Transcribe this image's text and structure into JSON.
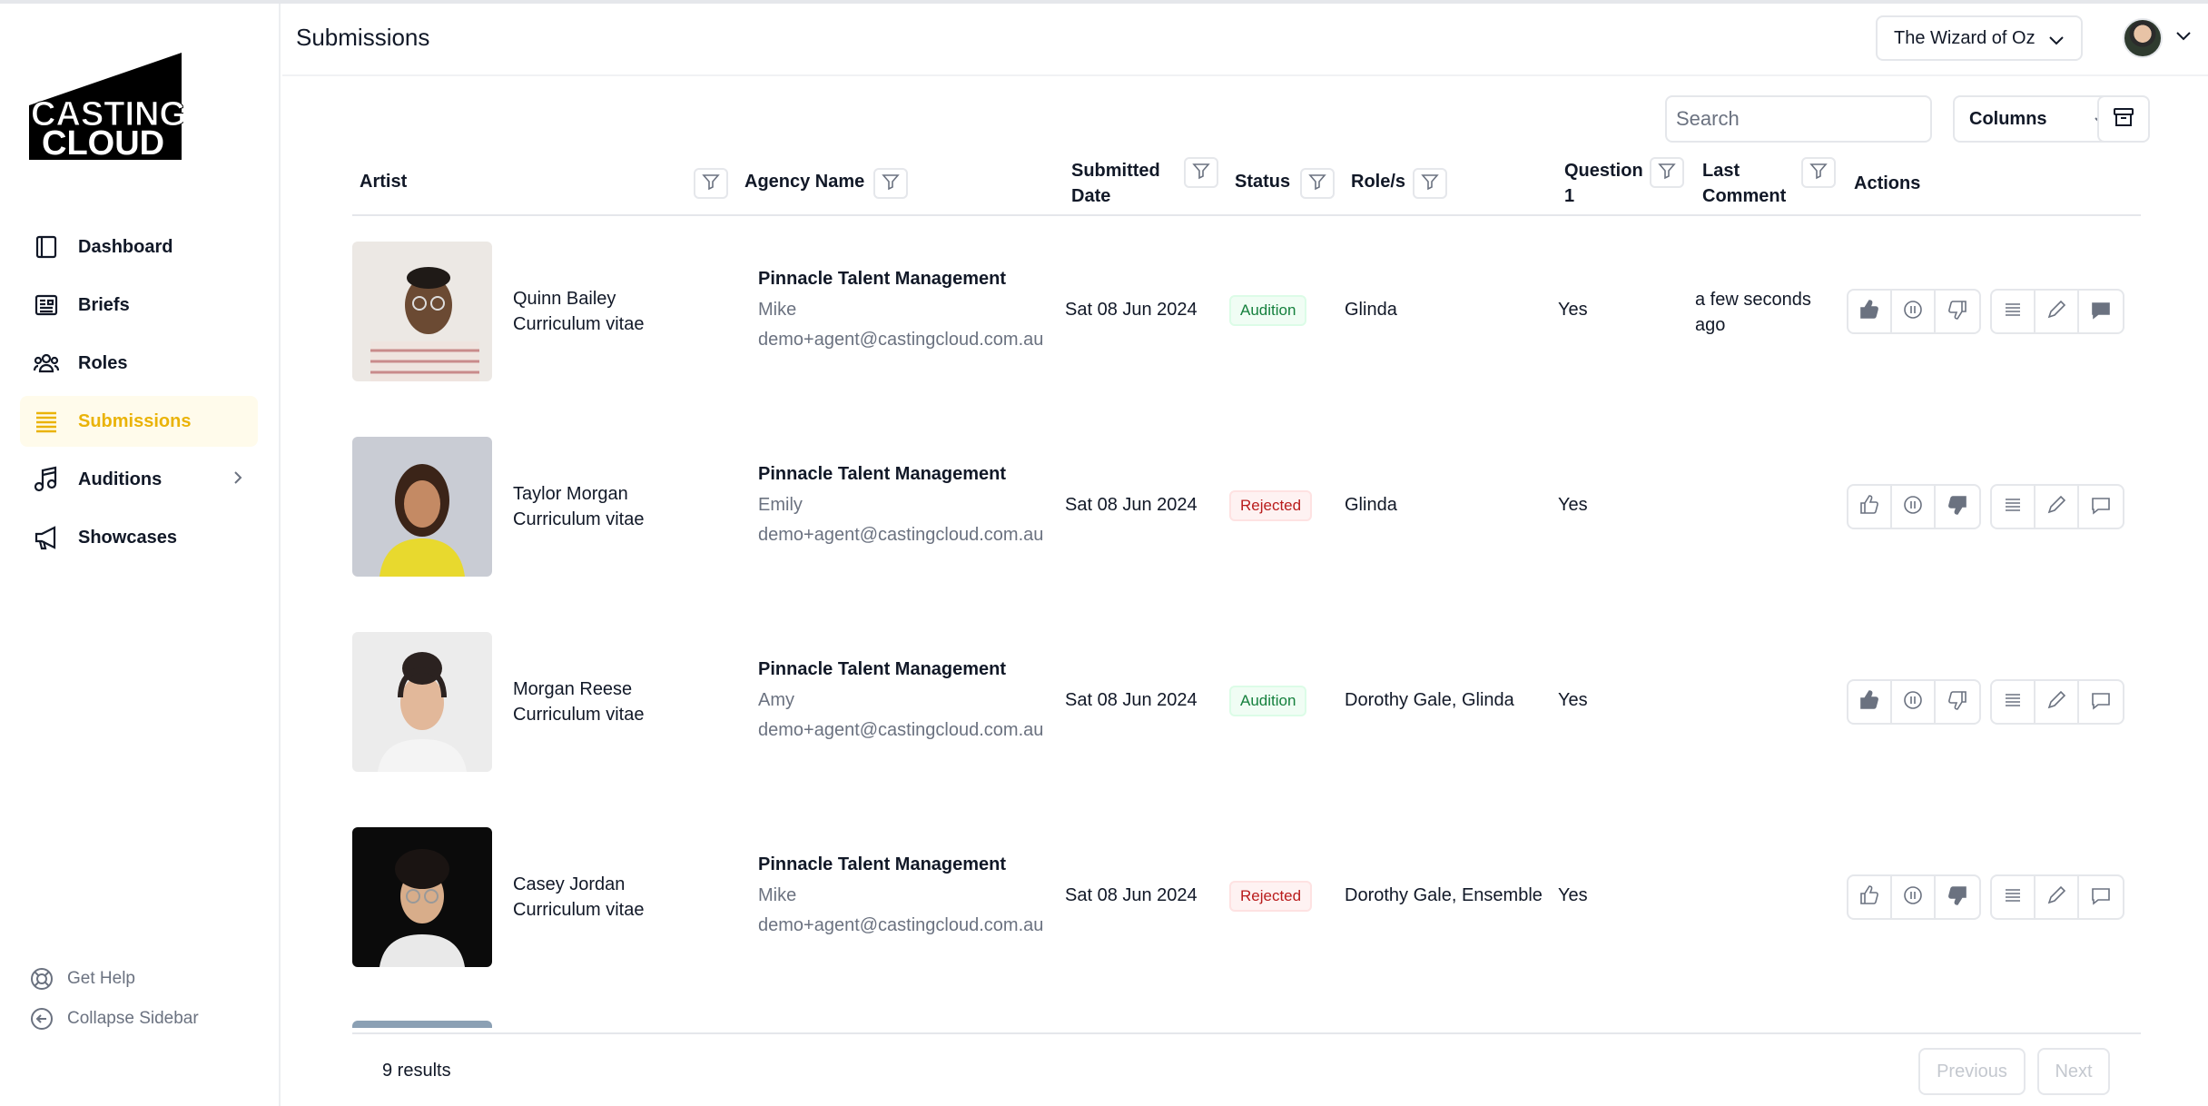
{
  "app": {
    "logo_line1": "CASTING",
    "logo_line2": "CLOUD",
    "brand_accent": "#eab308"
  },
  "sidebar": {
    "items": [
      {
        "label": "Dashboard",
        "icon": "dashboard-icon"
      },
      {
        "label": "Briefs",
        "icon": "briefs-icon"
      },
      {
        "label": "Roles",
        "icon": "roles-icon"
      },
      {
        "label": "Submissions",
        "icon": "submissions-icon",
        "active": true
      },
      {
        "label": "Auditions",
        "icon": "music-note-icon",
        "has_submenu": true
      },
      {
        "label": "Showcases",
        "icon": "megaphone-icon"
      }
    ],
    "help_label": "Get Help",
    "collapse_label": "Collapse Sidebar"
  },
  "header": {
    "title": "Submissions",
    "project": "The Wizard of Oz"
  },
  "toolbar": {
    "search_placeholder": "Search",
    "columns_label": "Columns"
  },
  "table": {
    "headers": {
      "artist": "Artist",
      "agency": "Agency Name",
      "date_l1": "Submitted",
      "date_l2": "Date",
      "status": "Status",
      "roles": "Role/s",
      "q1_l1": "Question",
      "q1_l2": "1",
      "comment_l1": "Last",
      "comment_l2": "Comment",
      "actions": "Actions"
    },
    "rows": [
      {
        "name": "Quinn Bailey",
        "cv": "Curriculum vitae",
        "agency": "Pinnacle Talent Management",
        "agent": "Mike",
        "email": "demo+agent@castingcloud.com.au",
        "date": "Sat 08 Jun 2024",
        "status": "Audition",
        "roles": "Glinda",
        "q1": "Yes",
        "comment_l1": "a few seconds",
        "comment_l2": "ago",
        "thumb": "up",
        "comment_filled": true
      },
      {
        "name": "Taylor Morgan",
        "cv": "Curriculum vitae",
        "agency": "Pinnacle Talent Management",
        "agent": "Emily",
        "email": "demo+agent@castingcloud.com.au",
        "date": "Sat 08 Jun 2024",
        "status": "Rejected",
        "roles": "Glinda",
        "q1": "Yes",
        "comment_l1": "",
        "comment_l2": "",
        "thumb": "down",
        "comment_filled": false
      },
      {
        "name": "Morgan Reese",
        "cv": "Curriculum vitae",
        "agency": "Pinnacle Talent Management",
        "agent": "Amy",
        "email": "demo+agent@castingcloud.com.au",
        "date": "Sat 08 Jun 2024",
        "status": "Audition",
        "roles": "Dorothy Gale, Glinda",
        "q1": "Yes",
        "comment_l1": "",
        "comment_l2": "",
        "thumb": "up",
        "comment_filled": false
      },
      {
        "name": "Casey Jordan",
        "cv": "Curriculum vitae",
        "agency": "Pinnacle Talent Management",
        "agent": "Mike",
        "email": "demo+agent@castingcloud.com.au",
        "date": "Sat 08 Jun 2024",
        "status": "Rejected",
        "roles": "Dorothy Gale, Ensemble",
        "q1": "Yes",
        "comment_l1": "",
        "comment_l2": "",
        "thumb": "down",
        "comment_filled": false
      }
    ]
  },
  "footer": {
    "results": "9 results",
    "previous_label": "Previous",
    "next_label": "Next"
  }
}
